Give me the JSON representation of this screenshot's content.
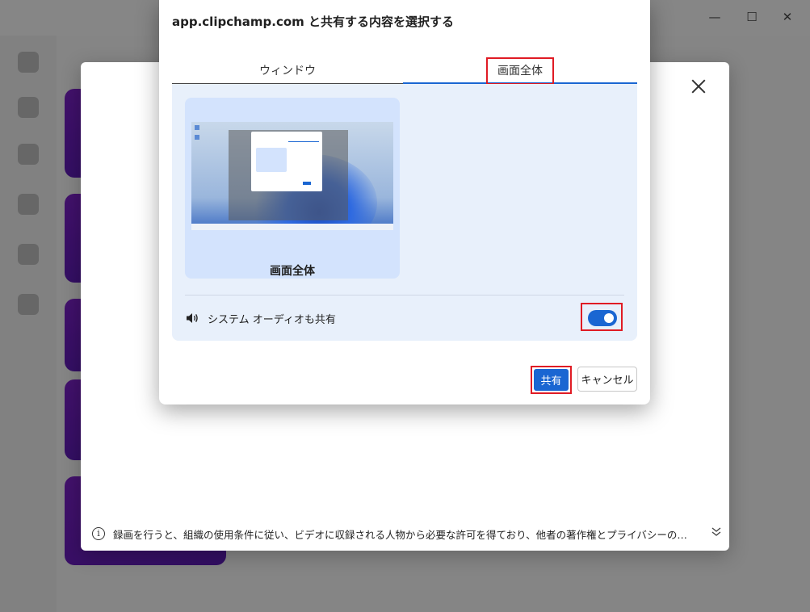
{
  "share_dialog": {
    "title": "app.clipchamp.com と共有する内容を選択する",
    "tabs": [
      {
        "label": "ウィンドウ",
        "selected": false
      },
      {
        "label": "画面全体",
        "selected": true
      }
    ],
    "source_card_label": "画面全体",
    "audio_label": "システム オーディオも共有",
    "audio_toggle_on": true,
    "share_button": "共有",
    "cancel_button": "キャンセル"
  },
  "record_modal": {
    "notice": "録画を行うと、組織の使用条件に従い、ビデオに収録される人物から必要な許可を得ており、他者の著作権とプライバシーの権利を..."
  },
  "colors": {
    "accent": "#1a66d2",
    "highlight_box": "#e01b24",
    "panel_bg": "#e8f0fb",
    "card_bg": "#d3e3fd"
  },
  "icons": [
    "speaker-icon",
    "info-icon",
    "close-icon",
    "chevron-double-down-icon"
  ]
}
